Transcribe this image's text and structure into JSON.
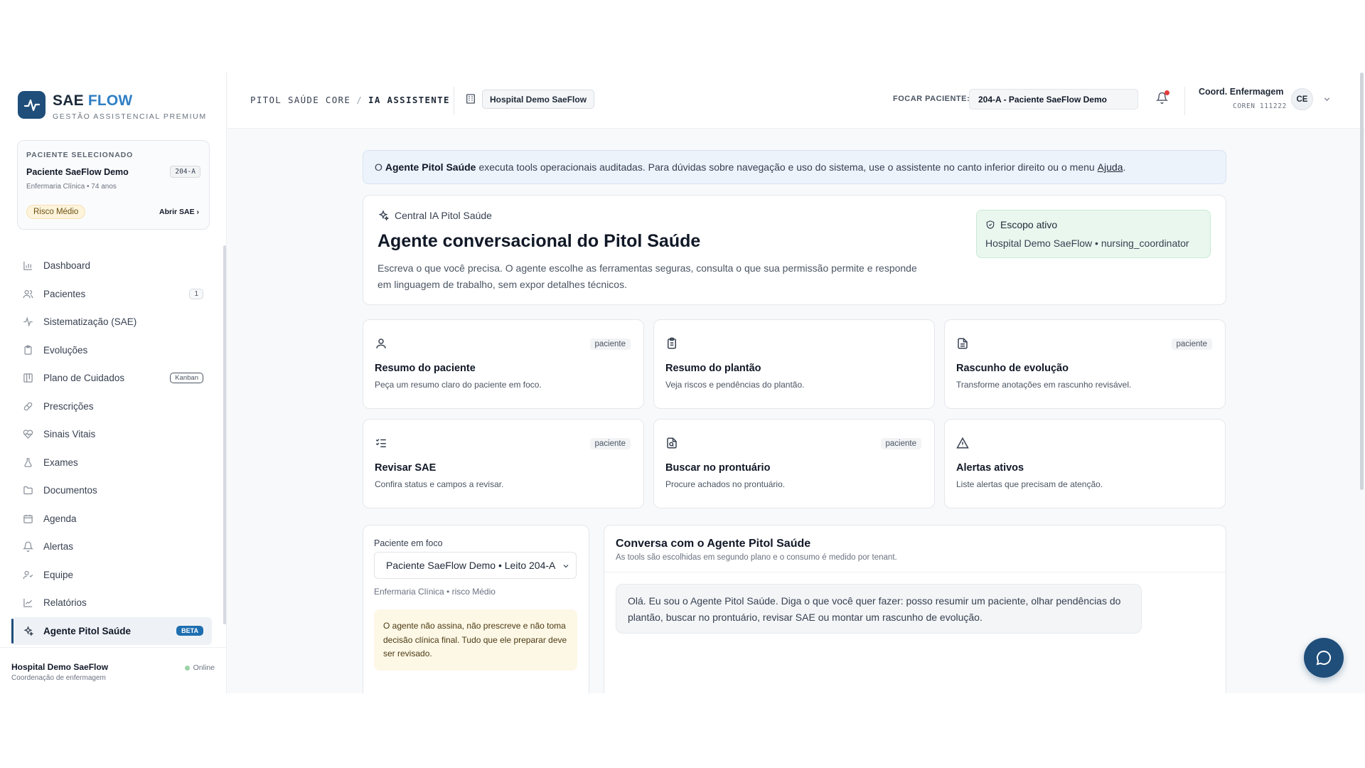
{
  "brand": {
    "name_main": "SAE",
    "name_accent": "FLOW",
    "tagline": "GESTÃO ASSISTENCIAL PREMIUM",
    "accent_color": "#1f4e7a"
  },
  "patient_card": {
    "label": "PACIENTE SELECIONADO",
    "name": "Paciente SaeFlow Demo",
    "bed": "204-A",
    "meta": "Enfermaria Clínica • 74 anos",
    "risk": "Risco Médio",
    "open_label": "Abrir SAE"
  },
  "nav": {
    "items": [
      {
        "label": "Dashboard",
        "icon": "bar-chart-icon"
      },
      {
        "label": "Pacientes",
        "icon": "users-icon",
        "badge": "1"
      },
      {
        "label": "Sistematização (SAE)",
        "icon": "activity-icon"
      },
      {
        "label": "Evoluções",
        "icon": "clipboard-icon"
      },
      {
        "label": "Plano de Cuidados",
        "icon": "board-icon",
        "badge": "Kanban"
      },
      {
        "label": "Prescrições",
        "icon": "pill-icon"
      },
      {
        "label": "Sinais Vitais",
        "icon": "heart-pulse-icon"
      },
      {
        "label": "Exames",
        "icon": "flask-icon"
      },
      {
        "label": "Documentos",
        "icon": "folder-icon"
      },
      {
        "label": "Agenda",
        "icon": "calendar-icon"
      },
      {
        "label": "Alertas",
        "icon": "bell-icon"
      },
      {
        "label": "Equipe",
        "icon": "team-icon"
      },
      {
        "label": "Relatórios",
        "icon": "line-chart-icon"
      },
      {
        "label": "Agente Pitol Saúde",
        "icon": "sparkles-icon",
        "badge": "BETA",
        "active": true
      }
    ]
  },
  "footer": {
    "hospital": "Hospital Demo SaeFlow",
    "role": "Coordenação de enfermagem",
    "status": "Online"
  },
  "header": {
    "breadcrumb": [
      "PITOL SAÚDE CORE",
      "/",
      "IA ASSISTENTE"
    ],
    "hospital": "Hospital Demo SaeFlow",
    "focus_label": "FOCAR PACIENTE:",
    "focus_value": "204-A - Paciente SaeFlow Demo",
    "user_name": "Coord. Enfermagem",
    "user_coren": "COREN 111222",
    "user_initials": "CE"
  },
  "info_bar": {
    "prefix": "O",
    "agent": "Agente Pitol Saúde",
    "text": "executa tools operacionais auditadas. Para dúvidas sobre navegação e uso do sistema, use o assistente no canto inferior direito ou o menu",
    "link": "Ajuda",
    "suffix": "."
  },
  "hero": {
    "eyebrow": "Central IA Pitol Saúde",
    "title": "Agente conversacional do Pitol Saúde",
    "desc": "Escreva o que você precisa. O agente escolhe as ferramentas seguras, consulta o que sua permissão permite e responde em linguagem de trabalho, sem expor detalhes técnicos.",
    "scope_title": "Escopo ativo",
    "scope_value": "Hospital Demo SaeFlow • nursing_coordinator"
  },
  "tools": [
    {
      "title": "Resumo do paciente",
      "desc": "Peça um resumo claro do paciente em foco.",
      "tag": "paciente",
      "icon": "user-icon"
    },
    {
      "title": "Resumo do plantão",
      "desc": "Veja riscos e pendências do plantão.",
      "tag": "",
      "icon": "clipboard-list-icon"
    },
    {
      "title": "Rascunho de evolução",
      "desc": "Transforme anotações em rascunho revisável.",
      "tag": "paciente",
      "icon": "file-text-icon"
    },
    {
      "title": "Revisar SAE",
      "desc": "Confira status e campos a revisar.",
      "tag": "paciente",
      "icon": "list-checks-icon"
    },
    {
      "title": "Buscar no prontuário",
      "desc": "Procure achados no prontuário.",
      "tag": "paciente",
      "icon": "file-search-icon"
    },
    {
      "title": "Alertas ativos",
      "desc": "Liste alertas que precisam de atenção.",
      "tag": "",
      "icon": "warning-icon"
    }
  ],
  "focus_panel": {
    "label": "Paciente em foco",
    "select_value": "Paciente SaeFlow Demo • Leito 204-A",
    "meta": "Enfermaria Clínica • risco Médio",
    "warning": "O agente não assina, não prescreve e não toma decisão clínica final. Tudo que ele preparar deve ser revisado."
  },
  "chat": {
    "title": "Conversa com o Agente Pitol Saúde",
    "subtitle": "As tools são escolhidas em segundo plano e o consumo é medido por tenant.",
    "message": "Olá. Eu sou o Agente Pitol Saúde. Diga o que você quer fazer: posso resumir um paciente, olhar pendências do plantão, buscar no prontuário, revisar SAE ou montar um rascunho de evolução."
  }
}
